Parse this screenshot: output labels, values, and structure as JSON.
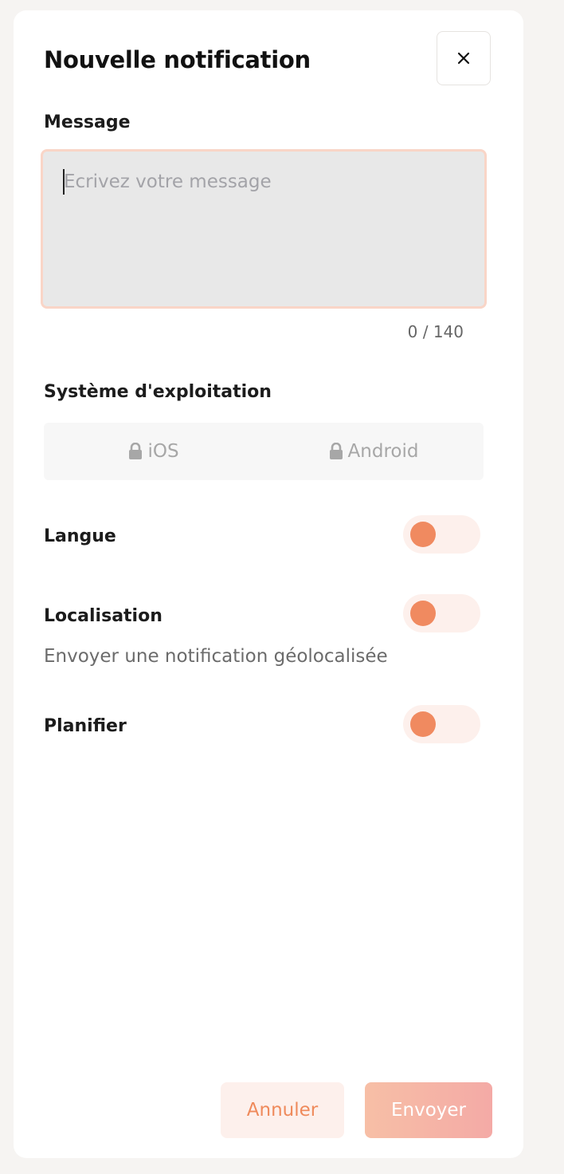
{
  "modal": {
    "title": "Nouvelle notification",
    "close_icon": "close-icon"
  },
  "message": {
    "label": "Message",
    "placeholder": "Ecrivez votre message",
    "value": "",
    "counter": "0 / 140"
  },
  "os": {
    "label": "Système d'exploitation",
    "options": [
      {
        "label": "iOS",
        "icon": "lock-icon",
        "locked": true
      },
      {
        "label": "Android",
        "icon": "lock-icon",
        "locked": true
      }
    ]
  },
  "settings": {
    "language": {
      "label": "Langue",
      "enabled": false
    },
    "location": {
      "label": "Localisation",
      "description": "Envoyer une notification géolocalisée",
      "enabled": false
    },
    "schedule": {
      "label": "Planifier",
      "enabled": false
    }
  },
  "actions": {
    "cancel_label": "Annuler",
    "send_label": "Envoyer"
  },
  "colors": {
    "accent": "#f08a60",
    "toggle_track": "#fdf0ec",
    "input_border": "#f9d5c7"
  }
}
